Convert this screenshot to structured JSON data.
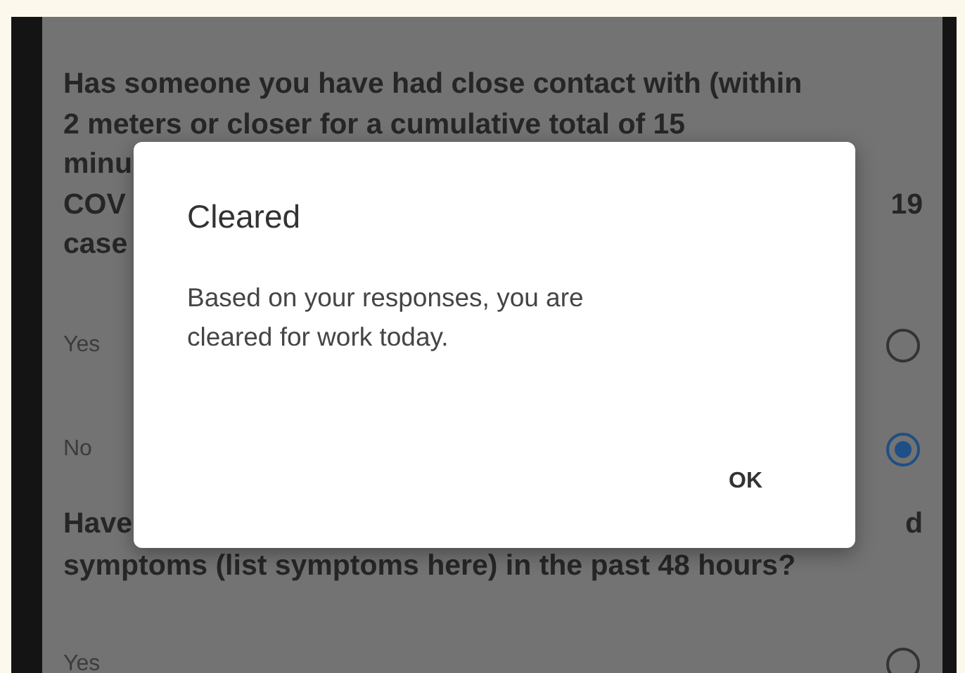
{
  "background_form": {
    "questions": [
      {
        "lines": [
          [
            "Has someone you have had close contact with (within"
          ],
          [
            "2 meters or closer for a cumulative total of 15"
          ],
          [
            "minu"
          ],
          [
            "COV",
            "19"
          ],
          [
            "case"
          ]
        ],
        "options": [
          {
            "label": "Yes",
            "selected": false
          },
          {
            "label": "No",
            "selected": true
          }
        ]
      },
      {
        "lines": [
          [
            "Have",
            "d"
          ],
          [
            "symptoms (list symptoms here) in the past 48 hours?"
          ]
        ],
        "options": [
          {
            "label": "Yes",
            "selected": false
          }
        ]
      }
    ]
  },
  "dialog": {
    "title": "Cleared",
    "message": "Based on your responses, you are cleared for work today.",
    "button": "OK"
  }
}
